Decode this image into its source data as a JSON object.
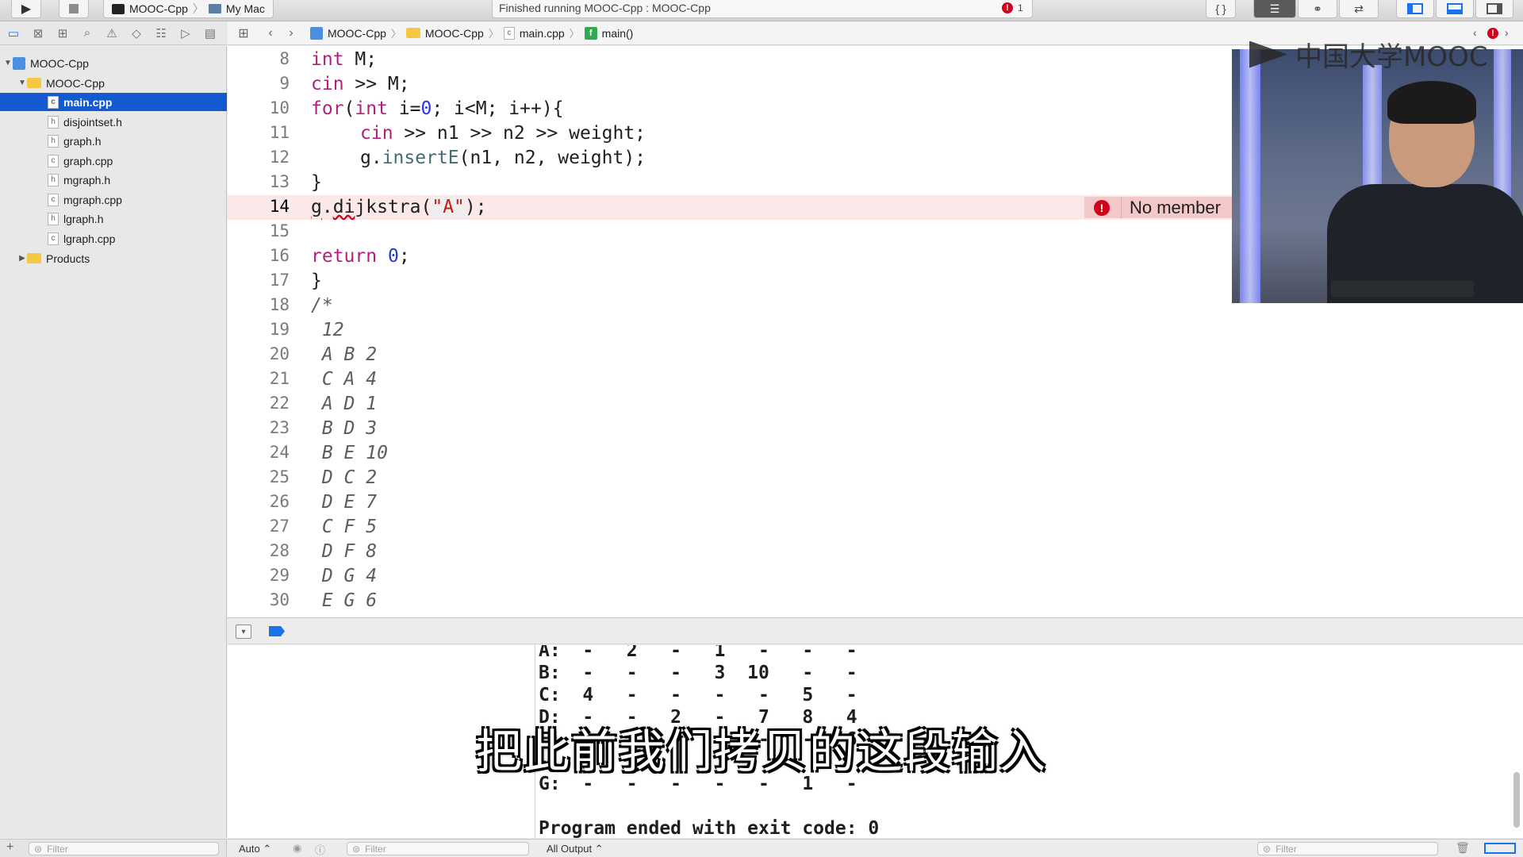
{
  "toolbar": {
    "scheme_target": "MOOC-Cpp",
    "scheme_device": "My Mac",
    "activity_text": "Finished running MOOC-Cpp : MOOC-Cpp",
    "error_count": "1",
    "run_icon": "play-icon",
    "stop_icon": "stop-icon"
  },
  "navigator": {
    "project": "MOOC-Cpp",
    "group": "MOOC-Cpp",
    "files": [
      {
        "name": "main.cpp",
        "type": "c"
      },
      {
        "name": "disjointset.h",
        "type": "h"
      },
      {
        "name": "graph.h",
        "type": "h"
      },
      {
        "name": "graph.cpp",
        "type": "c"
      },
      {
        "name": "mgraph.h",
        "type": "h"
      },
      {
        "name": "mgraph.cpp",
        "type": "c"
      },
      {
        "name": "lgraph.h",
        "type": "h"
      },
      {
        "name": "lgraph.cpp",
        "type": "c"
      }
    ],
    "products": "Products",
    "filter_placeholder": "Filter"
  },
  "jumpbar": {
    "crumbs": [
      "MOOC-Cpp",
      "MOOC-Cpp",
      "main.cpp",
      "main()"
    ],
    "error_count": "1"
  },
  "editor": {
    "lines": [
      {
        "n": "8",
        "text": "    int M;"
      },
      {
        "n": "9",
        "text": "    cin >> M;"
      },
      {
        "n": "10",
        "text": "    for(int i=0; i<M; i++){"
      },
      {
        "n": "11",
        "text": "        cin >> n1 >> n2 >> weight;"
      },
      {
        "n": "12",
        "text": "        g.insertE(n1, n2, weight);"
      },
      {
        "n": "13",
        "text": "    }"
      },
      {
        "n": "14",
        "text": "    g.dijkstra(\"A\");"
      },
      {
        "n": "15",
        "text": ""
      },
      {
        "n": "16",
        "text": "    return 0;"
      },
      {
        "n": "17",
        "text": "}"
      },
      {
        "n": "18",
        "text": "/*"
      },
      {
        "n": "19",
        "text": " 12"
      },
      {
        "n": "20",
        "text": " A B 2"
      },
      {
        "n": "21",
        "text": " C A 4"
      },
      {
        "n": "22",
        "text": " A D 1"
      },
      {
        "n": "23",
        "text": " B D 3"
      },
      {
        "n": "24",
        "text": " B E 10"
      },
      {
        "n": "25",
        "text": " D C 2"
      },
      {
        "n": "26",
        "text": " D E 7"
      },
      {
        "n": "27",
        "text": " C F 5"
      },
      {
        "n": "28",
        "text": " D F 8"
      },
      {
        "n": "29",
        "text": " D G 4"
      },
      {
        "n": "30",
        "text": " E G 6"
      }
    ],
    "error_message": "No member"
  },
  "console": {
    "lines": [
      "A:  -   2   -   1   -   -   -",
      "B:  -   -   -   3  10   -   -",
      "C:  4   -   -   -   -   5   -",
      "D:  -   -   2   -   7   8   4",
      "E:  -   -   -   -   -   -   6",
      "",
      "G:  -   -   -   -   -   1   -",
      "",
      "Program ended with exit code: 0"
    ],
    "output_selector": "All Output",
    "auto_selector": "Auto",
    "filter_placeholder": "Filter"
  },
  "overlay": {
    "watermark": "中国大学MOOC",
    "subtitle": "把此前我们拷贝的这段输入"
  }
}
